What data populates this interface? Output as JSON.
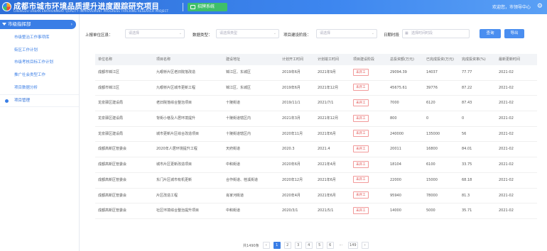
{
  "header": {
    "title": "成都市城市环境品质提升进度跟踪研究项目",
    "subtitle": "CHENGDU URBAN ENVIRONMENT QUALITY IMPROVEMENT PROGRESS TRACKING RESEARCH PROJECT",
    "system_button": "招牌系统",
    "user": "欢迎您，市领导中心"
  },
  "sidebar": {
    "section": "市级指挥部",
    "items": [
      "市级整治工作事项库",
      "街区工作计划",
      "市级考核目标工作计划",
      "推广社会类型工作",
      "项目数据分析",
      "项目管理"
    ]
  },
  "filters": {
    "unit_label": "上报单位区县：",
    "unit_placeholder": "请选择",
    "type_label": "数据类型：",
    "type_placeholder": "请选择类型",
    "status_label": "项目建设阶段：",
    "status_placeholder": "请选择",
    "date_label": "日期时段",
    "date_placeholder": "选择时间时段",
    "search_label": "查询",
    "export_label": "导出"
  },
  "table": {
    "headers": [
      "单位名称",
      "项目名称",
      "建设地址",
      "计划开工时间",
      "计划竣工时间",
      "项目建设阶段",
      "总投资额(万元)",
      "已完成投资(万元)",
      "完成投资率(%)",
      "最新更新时间"
    ],
    "rows": [
      [
        "成都市锦江区",
        "九眼桥片区老旧院落改造",
        "锦江区、东城区",
        "2019年6月",
        "2021年9月",
        "未开工",
        "29094.39",
        "14037",
        "77.77",
        "2021-02"
      ],
      [
        "成都市锦江区",
        "九眼桥片区城市更新工程",
        "锦江区、东城区",
        "2019年6月",
        "2021年12月",
        "未开工",
        "45675.61",
        "39776",
        "87.22",
        "2021-02"
      ],
      [
        "龙泉驿区建设局",
        "老旧院落综合整治项目",
        "十陵街道",
        "2019/11/1",
        "2021/7/1",
        "未开工",
        "7000",
        "6120",
        "87.43",
        "2021-02"
      ],
      [
        "龙泉驿区建设局",
        "背街小巷及人居环境提升",
        "十陵街道辖区内",
        "2021年3月",
        "2021年12月",
        "未开工",
        "800",
        "0",
        "0",
        "2021-02"
      ],
      [
        "龙泉驿区建设局",
        "城市更新片区综合改造项目",
        "十陵街道辖区内",
        "2020年11月",
        "2021年6月",
        "未开工",
        "240000",
        "135000",
        "56",
        "2021-02"
      ],
      [
        "成都高新区管委会",
        "2020年人居环境提升工程",
        "天府街道",
        "2020.3",
        "2021.4",
        "未开工",
        "20011",
        "16800",
        "84.01",
        "2021-02"
      ],
      [
        "成都高新区管委会",
        "城市片区更新改造项目",
        "中和街道",
        "2020年6月",
        "2021年4月",
        "未开工",
        "18104",
        "6100",
        "33.75",
        "2021-02"
      ],
      [
        "成都高新区管委会",
        "东门片区城市有机更新",
        "合作街道、桂溪街道",
        "2020年12月",
        "2021年6月",
        "未开工",
        "22000",
        "15000",
        "68.18",
        "2021-02"
      ],
      [
        "成都高新区管委会",
        "片区改造工程",
        "肖家河街道",
        "2020年4月",
        "2021年6月",
        "未开工",
        "95940",
        "78000",
        "81.3",
        "2021-02"
      ],
      [
        "成都高新区管委会",
        "社区环境综合整治提升项目",
        "中和街道",
        "2020/3/1",
        "2021/5/1",
        "未开工",
        "14000",
        "5000",
        "35.71",
        "2021-02"
      ]
    ]
  },
  "pagination": {
    "total": "共1490条",
    "pages": [
      "1",
      "2",
      "3",
      "4",
      "5",
      "6",
      "...",
      "149"
    ]
  },
  "colors": {
    "accent": "#3a7ee6",
    "system_button": "#3fbf6a",
    "status_tag": "#e05050"
  }
}
